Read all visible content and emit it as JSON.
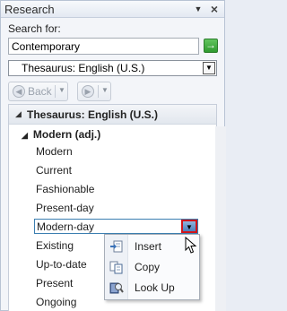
{
  "pane": {
    "title": "Research",
    "search_label": "Search for:",
    "search_value": "Contemporary",
    "reference_select": "Thesaurus: English (U.S.)",
    "back_label": "Back"
  },
  "results": {
    "header": "Thesaurus: English (U.S.)",
    "group_header": "Modern (adj.)",
    "words_before": [
      "Modern",
      "Current",
      "Fashionable",
      "Present-day"
    ],
    "selected_word": "Modern-day",
    "words_after": [
      "Existing",
      "Up-to-date",
      "Present",
      "Ongoing"
    ]
  },
  "context_menu": {
    "items": [
      {
        "label": "Insert",
        "icon": "insert-icon"
      },
      {
        "label": "Copy",
        "icon": "copy-icon"
      },
      {
        "label": "Look Up",
        "icon": "look-up-icon"
      }
    ]
  },
  "colors": {
    "highlight_border": "#d0151b",
    "selection_border": "#3c7fb1",
    "go_button": "#2f9a30"
  }
}
